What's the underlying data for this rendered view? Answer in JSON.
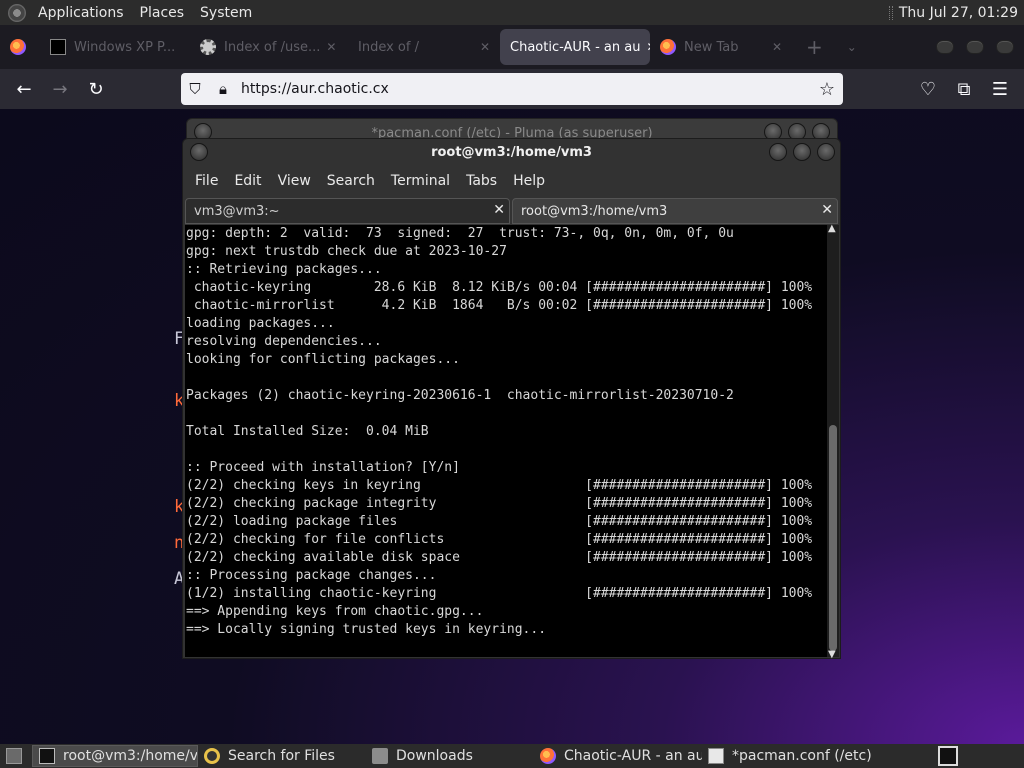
{
  "top_panel": {
    "menus": [
      "Applications",
      "Places",
      "System"
    ],
    "clock": "Thu Jul 27, 01:29"
  },
  "firefox": {
    "tabs": [
      {
        "label": "Windows XP P...",
        "favicon": "black-square-icon"
      },
      {
        "label": "Index of /use...",
        "favicon": "gear-icon"
      },
      {
        "label": "Index of /",
        "favicon": ""
      },
      {
        "label": "Chaotic-AUR - an au",
        "favicon": "",
        "active": true
      },
      {
        "label": "New Tab",
        "favicon": "firefox-icon"
      }
    ],
    "url": "https://aur.chaotic.cx"
  },
  "page_fragments": [
    "F",
    "k",
    "k",
    "n",
    "A"
  ],
  "pluma": {
    "title": "*pacman.conf (/etc) - Pluma (as superuser)"
  },
  "terminal": {
    "title": "root@vm3:/home/vm3",
    "menu": [
      "File",
      "Edit",
      "View",
      "Search",
      "Terminal",
      "Tabs",
      "Help"
    ],
    "tabs": [
      "vm3@vm3:~",
      "root@vm3:/home/vm3"
    ],
    "lines": [
      "gpg: depth: 2  valid:  73  signed:  27  trust: 73-, 0q, 0n, 0m, 0f, 0u",
      "gpg: next trustdb check due at 2023-10-27",
      ":: Retrieving packages...",
      " chaotic-keyring        28.6 KiB  8.12 KiB/s 00:04 [######################] 100%",
      " chaotic-mirrorlist      4.2 KiB  1864   B/s 00:02 [######################] 100%",
      "loading packages...",
      "resolving dependencies...",
      "looking for conflicting packages...",
      "",
      "Packages (2) chaotic-keyring-20230616-1  chaotic-mirrorlist-20230710-2",
      "",
      "Total Installed Size:  0.04 MiB",
      "",
      ":: Proceed with installation? [Y/n]",
      "(2/2) checking keys in keyring                     [######################] 100%",
      "(2/2) checking package integrity                   [######################] 100%",
      "(2/2) loading package files                        [######################] 100%",
      "(2/2) checking for file conflicts                  [######################] 100%",
      "(2/2) checking available disk space                [######################] 100%",
      ":: Processing package changes...",
      "(1/2) installing chaotic-keyring                   [######################] 100%",
      "==> Appending keys from chaotic.gpg...",
      "==> Locally signing trusted keys in keyring..."
    ]
  },
  "taskbar": {
    "items": [
      {
        "label": "root@vm3:/home/v...",
        "icon": "terminal-icon",
        "active": true
      },
      {
        "label": "Search for Files",
        "icon": "search-icon"
      },
      {
        "label": "Downloads",
        "icon": "folder-icon"
      },
      {
        "label": "Chaotic-AUR - an au...",
        "icon": "firefox-icon"
      },
      {
        "label": "*pacman.conf (/etc) ...",
        "icon": "pluma-icon"
      }
    ]
  }
}
